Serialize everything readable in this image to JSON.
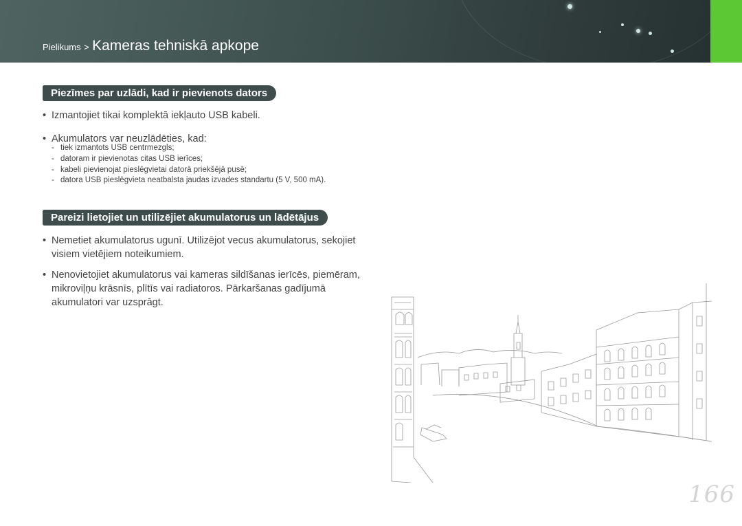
{
  "header": {
    "breadcrumb_parent": "Pielikums",
    "breadcrumb_separator": ">",
    "breadcrumb_current": "Kameras tehniskā apkope",
    "accent_color": "#5cc834",
    "band_color": "#3d4f4d"
  },
  "section1": {
    "title": "Piezīmes par uzlādi, kad ir pievienots dators",
    "bullets": [
      "Izmantojiet tikai komplektā iekļauto USB kabeli.",
      "Akumulators var neuzlādēties, kad:"
    ],
    "subitems": [
      "tiek izmantots USB centrmezgls;",
      "datoram ir pievienotas citas USB ierīces;",
      "kabeli pievienojat pieslēgvietai datorā priekšējā pusē;",
      "datora USB pieslēgvieta neatbalsta jaudas izvades standartu (5 V, 500 mA)."
    ]
  },
  "section2": {
    "title": "Pareizi lietojiet un utilizējiet akumulatorus un lādētājus",
    "bullets": [
      "Nemetiet akumulatorus ugunī. Utilizējot vecus akumulatorus, sekojiet visiem vietējiem noteikumiem.",
      "Nenovietojiet akumulatorus vai kameras sildīšanas ierīcēs, piemēram, mikroviļņu krāsnīs, plītīs vai radiatoros. Pārkaršanas gadījumā akumulatori var uzsprāgt."
    ]
  },
  "illustration": {
    "icon": "venice-canal-line-drawing-icon"
  },
  "page_number": "166"
}
